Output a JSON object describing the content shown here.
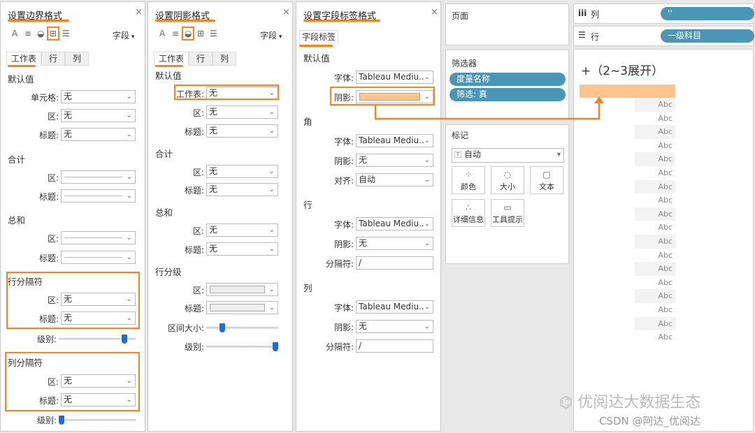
{
  "panel1": {
    "title": "设置边界格式",
    "field_menu": "字段",
    "tabs": [
      "工作表",
      "行",
      "列"
    ],
    "sections": [
      {
        "label": "默认值",
        "rows": [
          {
            "label": "单元格:",
            "value": "无"
          },
          {
            "label": "区:",
            "value": "无"
          },
          {
            "label": "标题:",
            "value": "无"
          }
        ]
      },
      {
        "label": "合计",
        "rows": [
          {
            "label": "区:",
            "value": "",
            "style": "line"
          },
          {
            "label": "标题:",
            "value": "",
            "style": "line"
          }
        ]
      },
      {
        "label": "总和",
        "rows": [
          {
            "label": "区:",
            "value": "",
            "style": "line"
          },
          {
            "label": "标题:",
            "value": "",
            "style": "line"
          }
        ]
      },
      {
        "label": "行分隔符",
        "rows": [
          {
            "label": "区:",
            "value": "无"
          },
          {
            "label": "标题:",
            "value": "无"
          }
        ],
        "level_label": "级别:",
        "level": 0.88
      },
      {
        "label": "列分隔符",
        "rows": [
          {
            "label": "区:",
            "value": "无"
          },
          {
            "label": "标题:",
            "value": "无"
          }
        ],
        "level_label": "级别:",
        "level": 0.0
      }
    ]
  },
  "panel2": {
    "title": "设置阴影格式",
    "field_menu": "字段",
    "tabs": [
      "工作表",
      "行",
      "列"
    ],
    "sections": [
      {
        "label": "默认值",
        "rows": [
          {
            "label": "工作表:",
            "value": "无"
          },
          {
            "label": "区:",
            "value": "无"
          },
          {
            "label": "标题:",
            "value": "无"
          }
        ]
      },
      {
        "label": "合计",
        "rows": [
          {
            "label": "区:",
            "value": "无"
          },
          {
            "label": "标题:",
            "value": "无"
          }
        ]
      },
      {
        "label": "总和",
        "rows": [
          {
            "label": "区:",
            "value": "无"
          },
          {
            "label": "标题:",
            "value": "无"
          }
        ]
      },
      {
        "label": "行分级",
        "rows": [
          {
            "label": "区:",
            "value": "",
            "style": "grey"
          },
          {
            "label": "标题:",
            "value": "",
            "style": "grey"
          }
        ],
        "band_label": "区间大小:",
        "band": 0.2,
        "level_label": "级别:",
        "level": 1.0
      }
    ]
  },
  "panel3": {
    "title": "设置字段标签格式",
    "tab": "字段标签",
    "sections": [
      {
        "label": "默认值",
        "rows": [
          {
            "label": "字体:",
            "value": "Tableau Mediu.."
          },
          {
            "label": "阴影:",
            "value": "",
            "style": "color",
            "color": "#ffc48e"
          }
        ]
      },
      {
        "label": "角",
        "rows": [
          {
            "label": "字体:",
            "value": "Tableau Mediu.."
          },
          {
            "label": "阴影:",
            "value": "无"
          },
          {
            "label": "对齐:",
            "value": "自动"
          }
        ]
      },
      {
        "label": "行",
        "rows": [
          {
            "label": "字体:",
            "value": "Tableau Mediu.."
          },
          {
            "label": "阴影:",
            "value": "无"
          },
          {
            "label": "分隔符:",
            "value": "/",
            "style": "text"
          }
        ]
      },
      {
        "label": "列",
        "rows": [
          {
            "label": "字体:",
            "value": "Tableau Mediu.."
          },
          {
            "label": "阴影:",
            "value": "无"
          },
          {
            "label": "分隔符:",
            "value": "/",
            "style": "text"
          }
        ]
      }
    ]
  },
  "pages": {
    "title": "页面"
  },
  "filters": {
    "title": "筛选器",
    "pills": [
      "度量名称",
      "筛选: 真"
    ]
  },
  "marks": {
    "title": "标记",
    "type": "自动",
    "buttons": [
      {
        "label": "颜色",
        "icon": "color-dots-icon"
      },
      {
        "label": "大小",
        "icon": "size-icon"
      },
      {
        "label": "文本",
        "icon": "text-icon"
      },
      {
        "label": "详细信息",
        "icon": "detail-icon"
      },
      {
        "label": "工具提示",
        "icon": "tooltip-icon"
      }
    ]
  },
  "columns_shelf": {
    "label": "列",
    "pill": "''"
  },
  "rows_shelf": {
    "label": "行",
    "pill": "一级科目"
  },
  "view": {
    "header": "+（2~3展开）",
    "highlight_color": "#ffc48e",
    "cells": [
      "Abc",
      "Abc",
      "Abc",
      "Abc",
      "Abc",
      "Abc",
      "Abc",
      "Abc",
      "Abc",
      "Abc",
      "Abc",
      "Abc",
      "Abc",
      "Abc",
      "Abc",
      "Abc",
      "Abc",
      "Abc"
    ]
  },
  "watermark": {
    "brand": "优阅达大数据生态",
    "credit": "CSDN @阿达_优阅达"
  },
  "colors": {
    "accent": "#f5841f",
    "pill": "#4a96b4",
    "slider": "#1f6fd1"
  }
}
